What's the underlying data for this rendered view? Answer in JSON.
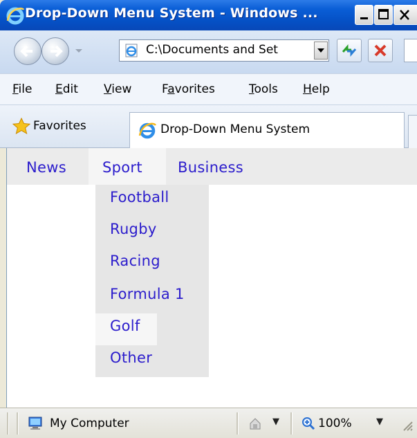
{
  "window": {
    "title": "Drop-Down Menu System - Windows ..."
  },
  "address_bar": {
    "url": "C:\\Documents and Set"
  },
  "menu_bar": {
    "items": [
      {
        "label": "File",
        "accel": "F",
        "rest": "ile"
      },
      {
        "label": "Edit",
        "accel": "E",
        "rest": "dit"
      },
      {
        "label": "View",
        "accel": "V",
        "rest": "iew"
      },
      {
        "label": "Favorites",
        "pre": "F",
        "accel": "a",
        "rest": "vorites"
      },
      {
        "label": "Tools",
        "accel": "T",
        "rest": "ools"
      },
      {
        "label": "Help",
        "accel": "H",
        "rest": "elp"
      }
    ]
  },
  "favorites_bar": {
    "favorites_label": "Favorites",
    "tab_title": "Drop-Down Menu System"
  },
  "page": {
    "nav": [
      "News",
      "Sport",
      "Business"
    ],
    "dropdown": [
      "Football",
      "Rugby",
      "Racing",
      "Formula 1",
      "Golf",
      "Other"
    ],
    "hovered_item": "Golf",
    "link_color": "#2b1ccc"
  },
  "status_bar": {
    "zone": "My Computer",
    "zoom": "100%"
  },
  "icons": [
    "ie-logo-icon",
    "back-arrow-icon",
    "forward-arrow-icon",
    "page-icon",
    "refresh-icon",
    "stop-icon",
    "favorites-star-icon",
    "computer-icon",
    "protected-mode-icon",
    "zoom-icon",
    "resize-grip-icon"
  ]
}
